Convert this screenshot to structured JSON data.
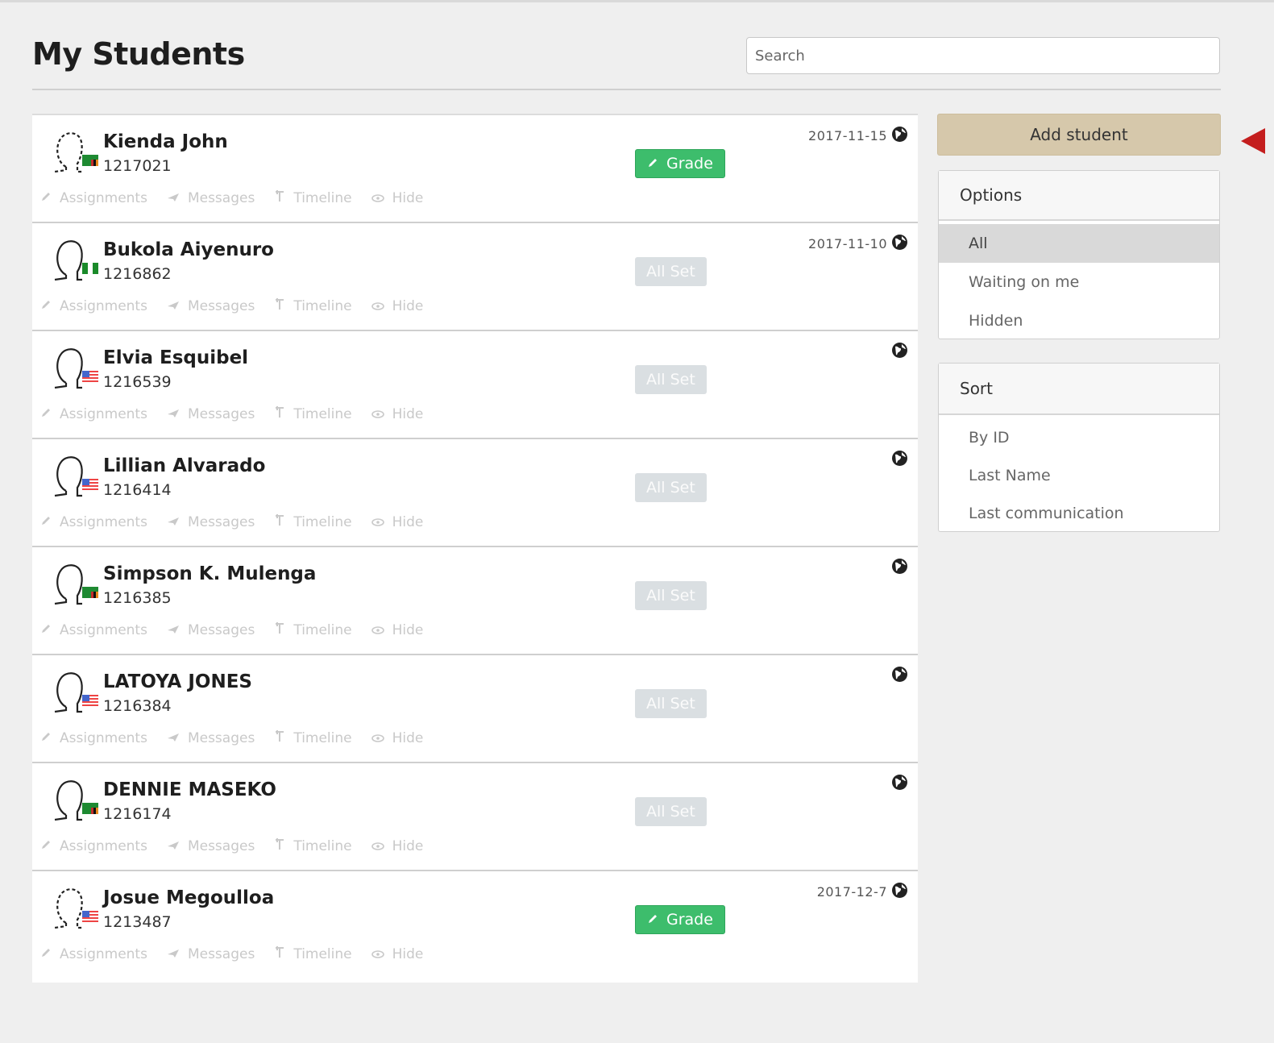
{
  "header": {
    "title": "My Students",
    "search_placeholder": "Search"
  },
  "actions": {
    "assignments": "Assignments",
    "messages": "Messages",
    "timeline": "Timeline",
    "hide": "Hide"
  },
  "students": [
    {
      "name": "Kienda John",
      "id": "1217021",
      "date": "2017-11-15",
      "status": "Grade",
      "flag": "zambia",
      "avatar": "dashed"
    },
    {
      "name": "Bukola Aiyenuro",
      "id": "1216862",
      "date": "2017-11-10",
      "status": "All Set",
      "flag": "nigeria",
      "avatar": "solid"
    },
    {
      "name": "Elvia Esquibel",
      "id": "1216539",
      "date": "",
      "status": "All Set",
      "flag": "usa",
      "avatar": "solid"
    },
    {
      "name": "Lillian Alvarado",
      "id": "1216414",
      "date": "",
      "status": "All Set",
      "flag": "usa",
      "avatar": "solid"
    },
    {
      "name": "Simpson K. Mulenga",
      "id": "1216385",
      "date": "",
      "status": "All Set",
      "flag": "zambia",
      "avatar": "solid"
    },
    {
      "name": "LATOYA JONES",
      "id": "1216384",
      "date": "",
      "status": "All Set",
      "flag": "usa",
      "avatar": "solid"
    },
    {
      "name": "DENNIE MASEKO",
      "id": "1216174",
      "date": "",
      "status": "All Set",
      "flag": "zambia",
      "avatar": "solid"
    },
    {
      "name": "Josue Megoulloa",
      "id": "1213487",
      "date": "2017-12-7",
      "status": "Grade",
      "flag": "usa",
      "avatar": "dashed"
    }
  ],
  "sidebar": {
    "add_student": "Add student",
    "options": {
      "title": "Options",
      "items": [
        "All",
        "Waiting on me",
        "Hidden"
      ],
      "active": "All"
    },
    "sort": {
      "title": "Sort",
      "items": [
        "By ID",
        "Last Name",
        "Last communication"
      ]
    }
  },
  "colors": {
    "grade_green": "#3dbd6c",
    "allset_gray": "#dadfe2",
    "add_button": "#d6c8ab",
    "arrow_red": "#c41e1e"
  }
}
